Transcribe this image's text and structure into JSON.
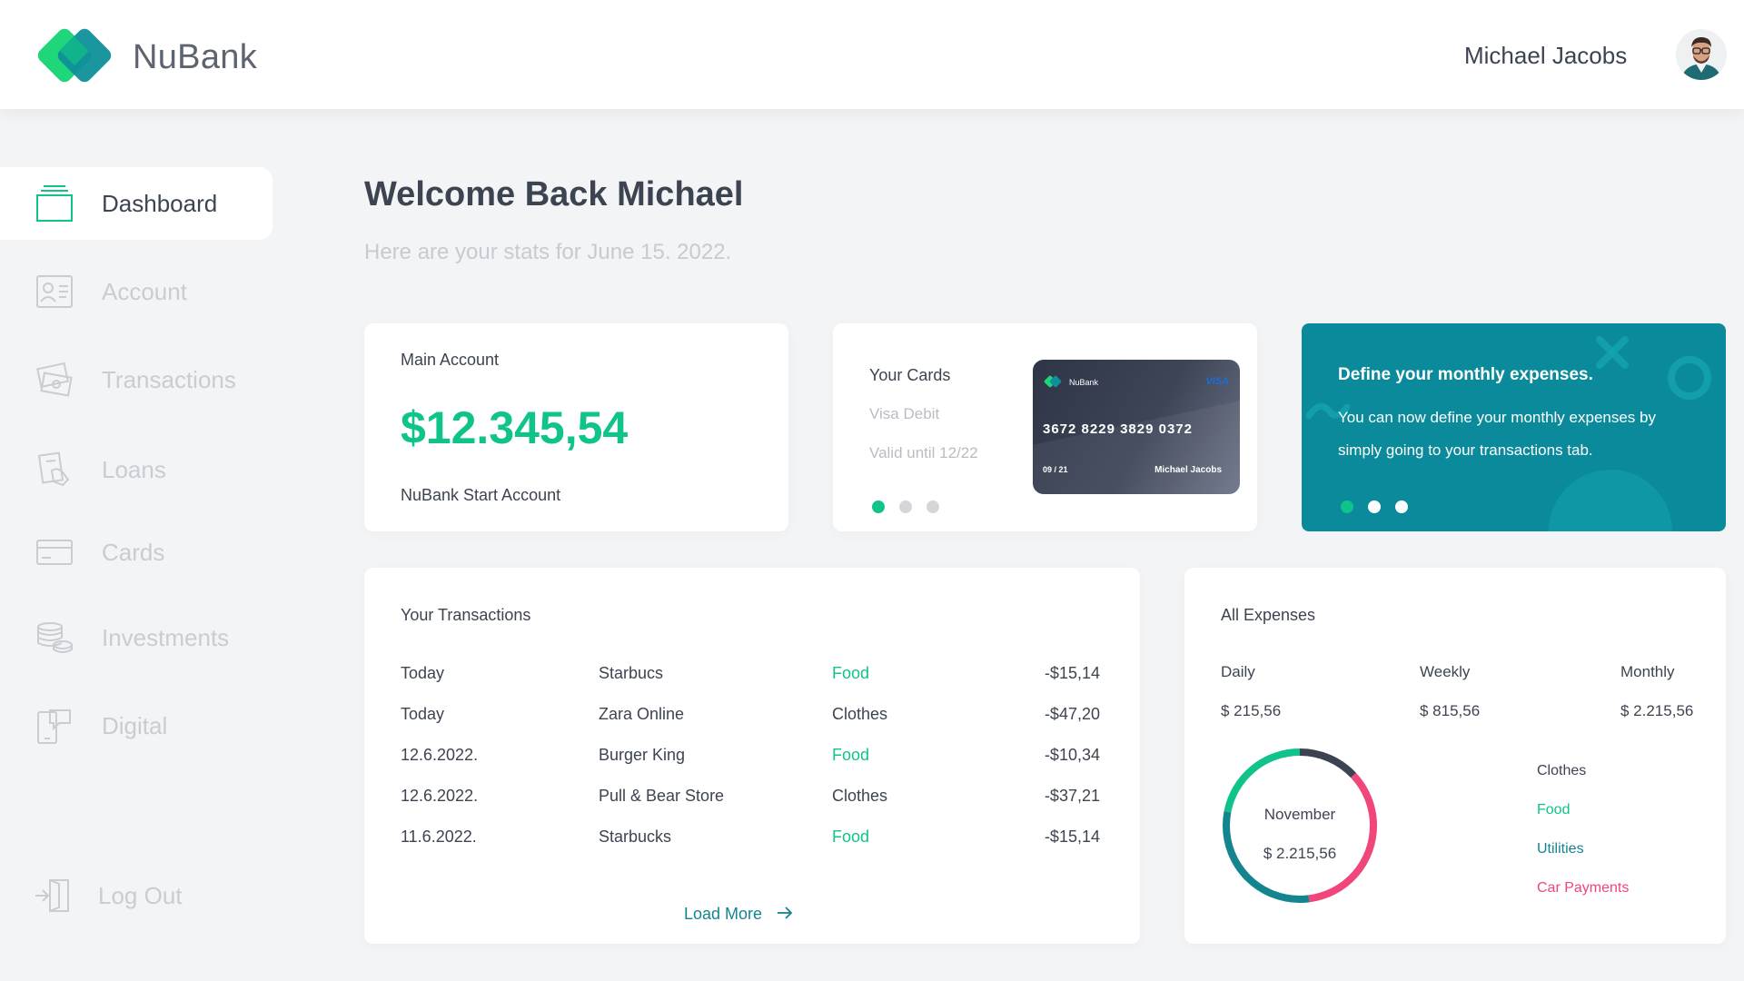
{
  "app": {
    "name": "NuBank",
    "user_name": "Michael Jacobs"
  },
  "sidebar": {
    "items": [
      {
        "label": "Dashboard",
        "icon": "dashboard-icon",
        "active": true
      },
      {
        "label": "Account",
        "icon": "account-icon",
        "active": false
      },
      {
        "label": "Transactions",
        "icon": "transactions-icon",
        "active": false
      },
      {
        "label": "Loans",
        "icon": "loans-icon",
        "active": false
      },
      {
        "label": "Cards",
        "icon": "cards-icon",
        "active": false
      },
      {
        "label": "Investments",
        "icon": "investments-icon",
        "active": false
      },
      {
        "label": "Digital",
        "icon": "digital-icon",
        "active": false
      }
    ],
    "logout_label": "Log Out"
  },
  "main": {
    "welcome": "Welcome Back Michael",
    "subtitle": "Here are your stats for June 15. 2022."
  },
  "main_account": {
    "title": "Main Account",
    "balance": "$12.345,54",
    "account_name": "NuBank Start Account"
  },
  "cards": {
    "title": "Your Cards",
    "type": "Visa Debit",
    "valid": "Valid until 12/22",
    "card_brand": "NuBank",
    "card_network": "VISA",
    "card_number": "3672 8229 3829 0372",
    "card_expiry": "09 / 21",
    "card_holder": "Michael Jacobs",
    "slide_count": 3,
    "active_slide": 1
  },
  "promo": {
    "title": "Define your monthly expenses.",
    "text": "You can now define your monthly expenses by simply going to your transactions tab.",
    "slide_count": 3,
    "active_slide": 1
  },
  "transactions": {
    "title": "Your Transactions",
    "rows": [
      {
        "date": "Today",
        "merchant": "Starbucs",
        "category": "Food",
        "amount": "-$15,14"
      },
      {
        "date": "Today",
        "merchant": "Zara Online",
        "category": "Clothes",
        "amount": "-$47,20"
      },
      {
        "date": "12.6.2022.",
        "merchant": "Burger King",
        "category": "Food",
        "amount": "-$10,34"
      },
      {
        "date": "12.6.2022.",
        "merchant": "Pull & Bear Store",
        "category": "Clothes",
        "amount": "-$37,21"
      },
      {
        "date": "11.6.2022.",
        "merchant": "Starbucks",
        "category": "Food",
        "amount": "-$15,14"
      }
    ],
    "load_more": "Load More"
  },
  "expenses": {
    "title": "All Expenses",
    "periods": [
      {
        "label": "Daily",
        "value": "$ 215,56"
      },
      {
        "label": "Weekly",
        "value": "$ 815,56"
      },
      {
        "label": "Monthly",
        "value": "$ 2.215,56"
      }
    ],
    "donut_month": "November",
    "donut_total": "$ 2.215,56",
    "legend": [
      {
        "label": "Clothes",
        "color": "#3d4451",
        "share": 0.13
      },
      {
        "label": "Food",
        "color": "#10c38b",
        "share": 0.22
      },
      {
        "label": "Utilities",
        "color": "#14848f",
        "share": 0.3
      },
      {
        "label": "Car Payments",
        "color": "#f0467a",
        "share": 0.35
      }
    ]
  },
  "colors": {
    "accent_green": "#10c38b",
    "teal": "#14848f",
    "pink": "#f0467a",
    "dark_text": "#3d4451",
    "promo_bg": "#0a8a9a"
  }
}
